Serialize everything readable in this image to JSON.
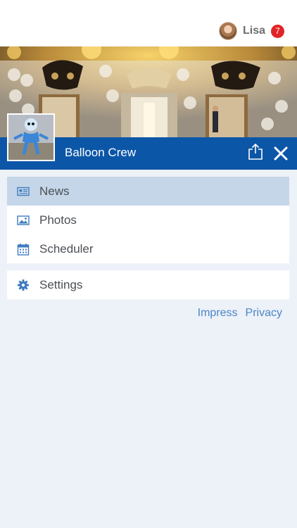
{
  "user": {
    "name": "Lisa",
    "notifications": "7"
  },
  "group": {
    "name": "Balloon Crew"
  },
  "menu": {
    "items": [
      {
        "label": "News",
        "icon": "newspaper-icon",
        "active": true
      },
      {
        "label": "Photos",
        "icon": "image-icon",
        "active": false
      },
      {
        "label": "Scheduler",
        "icon": "calendar-icon",
        "active": false
      }
    ],
    "settings": {
      "label": "Settings",
      "icon": "gear-icon"
    }
  },
  "footer": {
    "impress": "Impress",
    "privacy": "Privacy"
  },
  "colors": {
    "accent": "#0c56a8",
    "active_row": "#c5d6e8",
    "link": "#4a86c6",
    "badge": "#e02427",
    "background": "#edf1f8"
  }
}
